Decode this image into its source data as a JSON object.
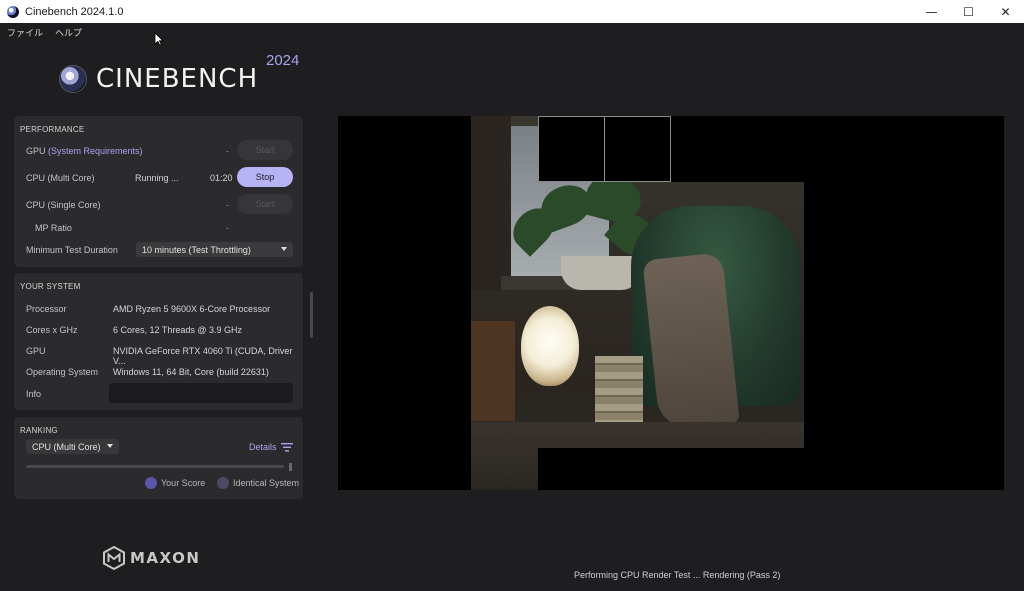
{
  "window": {
    "title": "Cinebench 2024.1.0",
    "controls": [
      "—",
      "☐",
      "✕"
    ]
  },
  "menu": {
    "items": [
      "ファイル",
      "ヘルプ"
    ]
  },
  "logo": {
    "name": "CINEBENCH",
    "year": "2024"
  },
  "performance": {
    "title": "PERFORMANCE",
    "rows": [
      {
        "label": "GPU",
        "link": "(System Requirements)",
        "status": "",
        "time": "-",
        "button": "Start"
      },
      {
        "label": "CPU (Multi Core)",
        "status": "Running ...",
        "time": "01:20",
        "button": "Stop"
      },
      {
        "label": "CPU (Single Core)",
        "status": "",
        "time": "-",
        "button": "Start"
      },
      {
        "label": "MP Ratio",
        "status": "",
        "time": "-",
        "button": ""
      }
    ],
    "duration_label": "Minimum Test Duration",
    "duration_value": "10 minutes (Test Throttling)"
  },
  "system": {
    "title": "YOUR SYSTEM",
    "rows": [
      {
        "label": "Processor",
        "value": "AMD Ryzen 5 9600X 6-Core Processor"
      },
      {
        "label": "Cores x GHz",
        "value": "6 Cores, 12 Threads @ 3.9 GHz"
      },
      {
        "label": "GPU",
        "value": "NVIDIA GeForce RTX 4060 Ti (CUDA, Driver V..."
      },
      {
        "label": "Operating System",
        "value": "Windows 11, 64 Bit, Core (build 22631)"
      },
      {
        "label": "Info",
        "value": ""
      }
    ]
  },
  "ranking": {
    "title": "RANKING",
    "selected": "CPU (Multi Core)",
    "details_label": "Details",
    "legend": [
      {
        "label": "Your Score",
        "color": "#5a56a8"
      },
      {
        "label": "Identical System",
        "color": "#4a4a66"
      }
    ]
  },
  "brand": {
    "maxon": "MAXON"
  },
  "status": {
    "text": "Performing CPU Render Test ... Rendering (Pass 2)"
  },
  "colors": {
    "accent": "#a9a4f0",
    "stop_button": "#b7b2f4",
    "panel": "#2b2b2e",
    "background": "#1e1e20"
  }
}
